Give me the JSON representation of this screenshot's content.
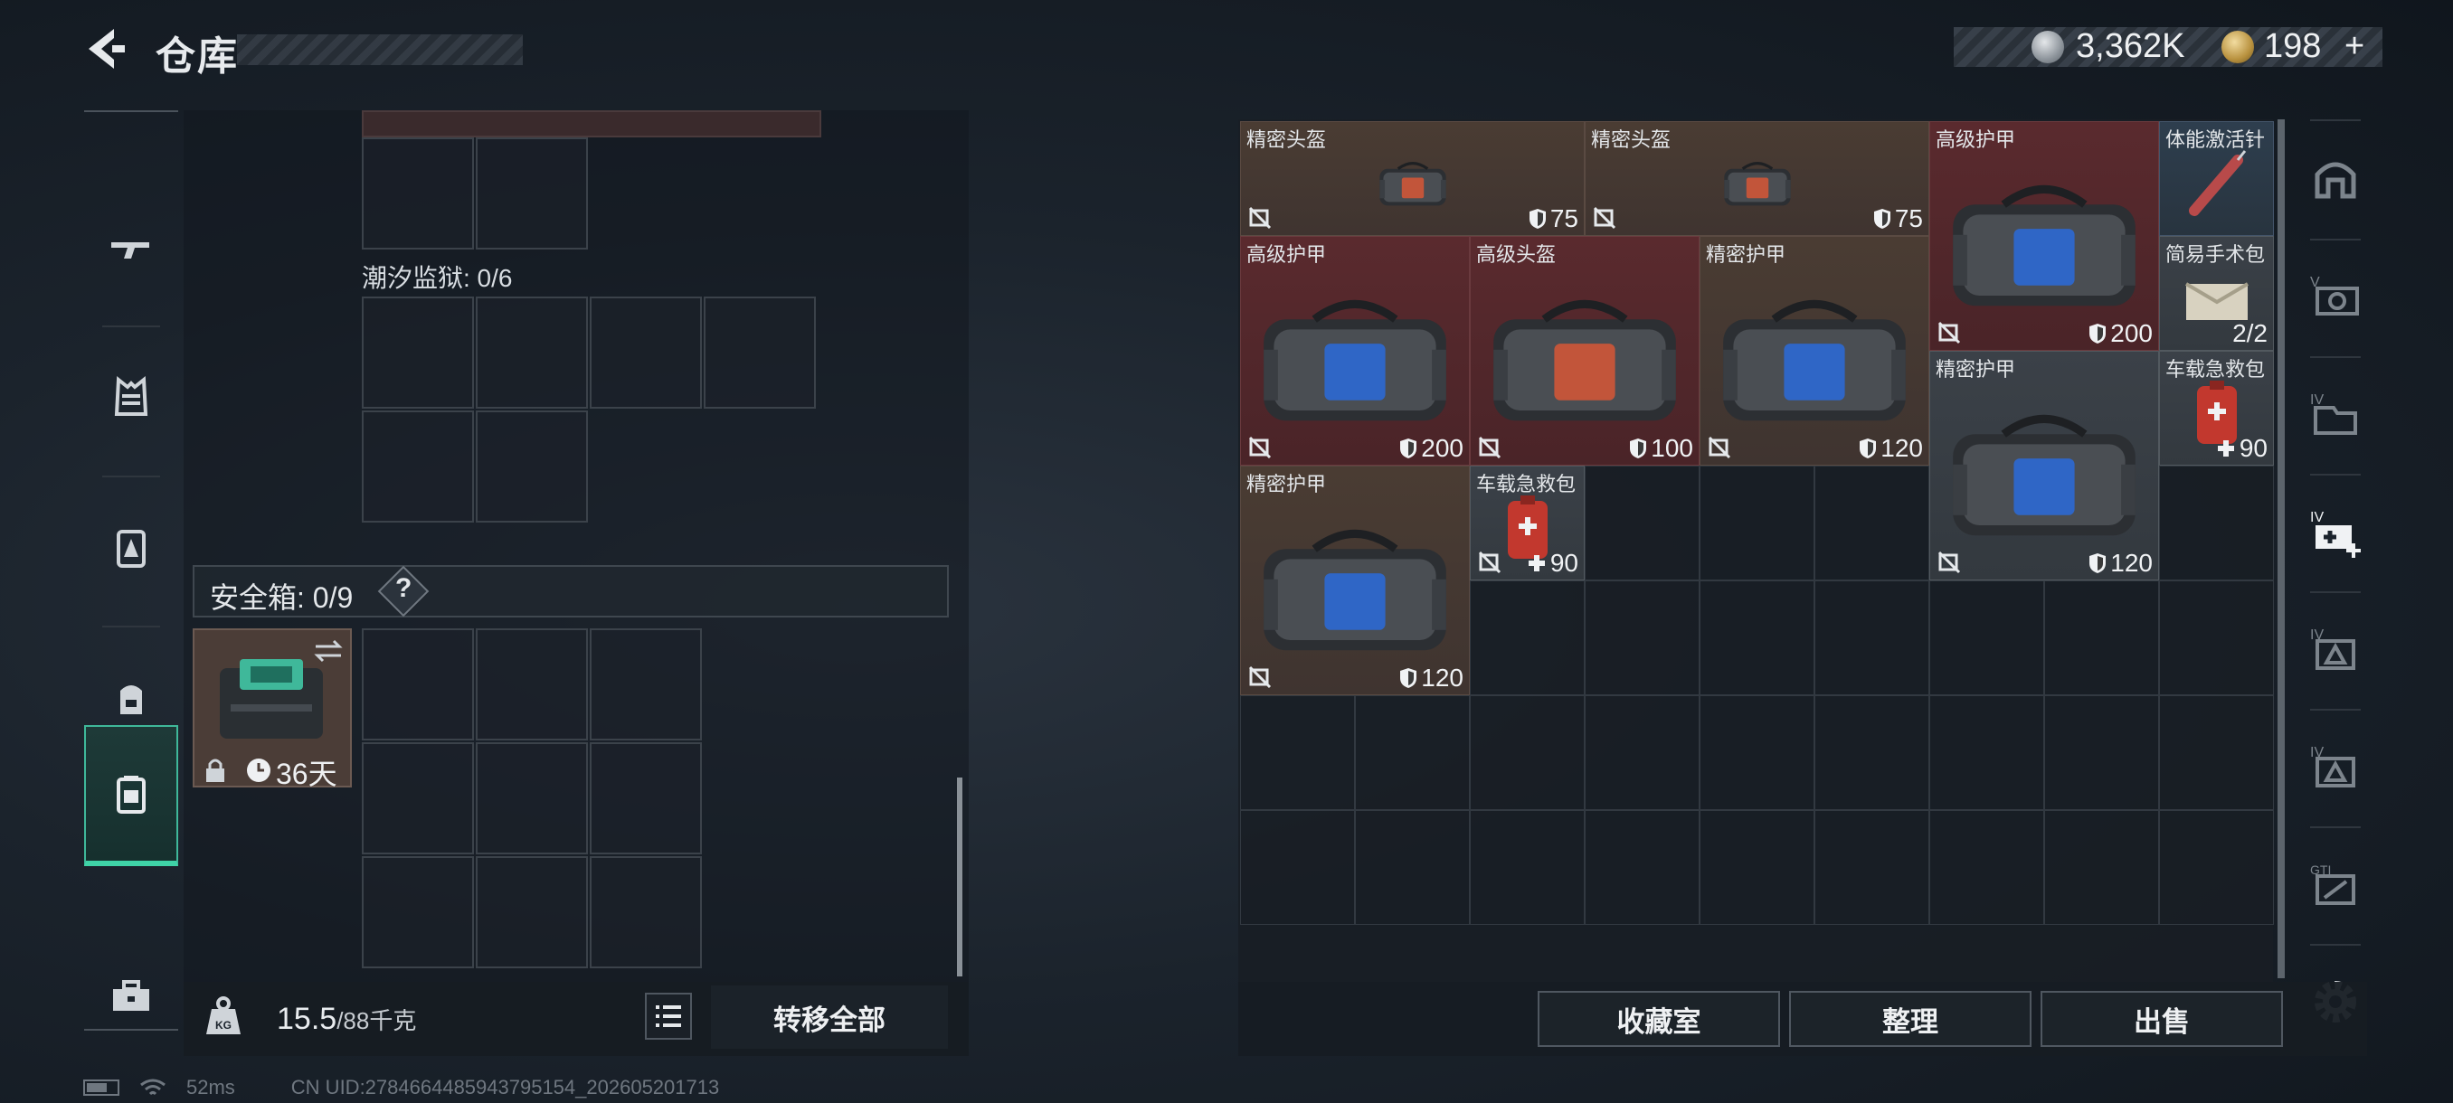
{
  "header": {
    "title": "仓库",
    "back_icon": "back-arrow-icon"
  },
  "currency": {
    "silver": "3,362K",
    "gold": "198",
    "gold_plus": "+"
  },
  "left_nav": {
    "items": [
      "rifle-icon",
      "vest-icon",
      "armor-icon",
      "backpack-icon",
      "safebox-icon",
      "toolbox-icon"
    ],
    "active": "safebox-icon"
  },
  "containers": {
    "prison_label": "潮汐监狱: 0/6",
    "safe_label": "安全箱: 0/9",
    "safe_help": "?",
    "safe_item": {
      "timer": "36天"
    }
  },
  "bottom": {
    "weight": "15.5",
    "weight_max": "/88千克",
    "transfer_all": "转移全部"
  },
  "stash_items": [
    {
      "name": "精密头盔",
      "value": "75",
      "type": "shield"
    },
    {
      "name": "精密头盔",
      "value": "75",
      "type": "shield"
    },
    {
      "name": "高级护甲",
      "value": "200",
      "type": "shield"
    },
    {
      "name": "体能激活针",
      "value": "",
      "type": "none"
    },
    {
      "name": "高级护甲",
      "value": "200",
      "type": "shield"
    },
    {
      "name": "高级头盔",
      "value": "100",
      "type": "shield"
    },
    {
      "name": "精密护甲",
      "value": "120",
      "type": "shield"
    },
    {
      "name": "简易手术包",
      "value": "2/2",
      "type": "count"
    },
    {
      "name": "精密护甲",
      "value": "120",
      "type": "shield"
    },
    {
      "name": "车载急救包",
      "value": "90",
      "type": "plus"
    },
    {
      "name": "精密护甲",
      "value": "120",
      "type": "shield"
    },
    {
      "name": "车载急救包",
      "value": "90",
      "type": "plus"
    }
  ],
  "actions": {
    "collection": "收藏室",
    "sort": "整理",
    "sell": "出售"
  },
  "footer": {
    "ping": "52ms",
    "uid": "CN UID:2784664485943795154_202605201713"
  },
  "colors": {
    "accent": "#3fd3a7",
    "red_tier": "#5a2a2e",
    "brown_tier": "#4a3c33"
  }
}
